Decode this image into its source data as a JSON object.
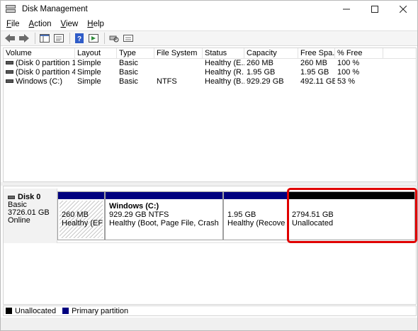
{
  "window": {
    "title": "Disk Management"
  },
  "menu": [
    {
      "label": "File",
      "key": "F",
      "rest": "ile"
    },
    {
      "label": "Action",
      "key": "A",
      "rest": "ction"
    },
    {
      "label": "View",
      "key": "V",
      "rest": "iew"
    },
    {
      "label": "Help",
      "key": "H",
      "rest": "elp"
    }
  ],
  "volume_list": {
    "headers": [
      "Volume",
      "Layout",
      "Type",
      "File System",
      "Status",
      "Capacity",
      "Free Spa...",
      "% Free"
    ],
    "rows": [
      [
        "(Disk 0 partition 1)",
        "Simple",
        "Basic",
        "",
        "Healthy (E...",
        "260 MB",
        "260 MB",
        "100 %"
      ],
      [
        "(Disk 0 partition 4)",
        "Simple",
        "Basic",
        "",
        "Healthy (R...",
        "1.95 GB",
        "1.95 GB",
        "100 %"
      ],
      [
        "Windows (C:)",
        "Simple",
        "Basic",
        "NTFS",
        "Healthy (B...",
        "929.29 GB",
        "492.11 GB",
        "53 %"
      ]
    ]
  },
  "disk0": {
    "name": "Disk 0",
    "type": "Basic",
    "size": "3726.01 GB",
    "status": "Online",
    "partitions": {
      "efi": {
        "size": "260 MB",
        "status": "Healthy (EFI S"
      },
      "windows": {
        "name": "Windows  (C:)",
        "size": "929.29 GB NTFS",
        "status": "Healthy (Boot, Page File, Crash Dump"
      },
      "recovery": {
        "size": "1.95 GB",
        "status": "Healthy (Recovery I"
      },
      "unallocated": {
        "size": "2794.51 GB",
        "status": "Unallocated"
      }
    }
  },
  "legend": {
    "unallocated": "Unallocated",
    "primary": "Primary partition"
  },
  "colors": {
    "primary": "#00007f",
    "unallocated": "#000000",
    "highlight": "#e00000"
  }
}
